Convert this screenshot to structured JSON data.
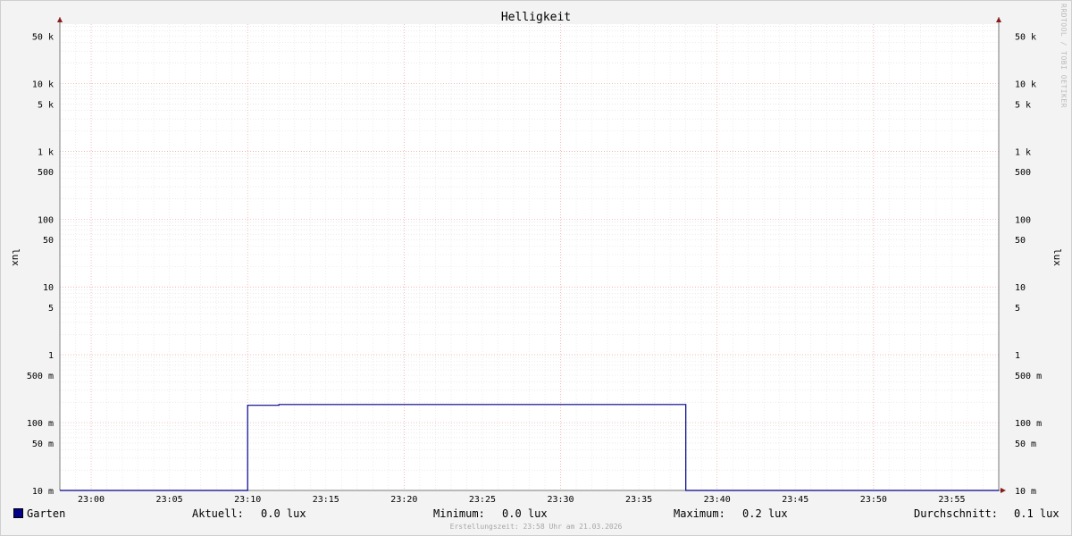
{
  "chart_data": {
    "type": "line",
    "title": "Helligkeit",
    "ylabel": "lux",
    "ylabel_right": "lux",
    "yscale": "log",
    "ylim": [
      0.01,
      75000
    ],
    "xlim": [
      "22:58",
      "23:58"
    ],
    "y_ticks": [
      {
        "value": 50000,
        "label": "50 k"
      },
      {
        "value": 10000,
        "label": "10 k"
      },
      {
        "value": 5000,
        "label": "5 k"
      },
      {
        "value": 1000,
        "label": "1 k"
      },
      {
        "value": 500,
        "label": "500"
      },
      {
        "value": 100,
        "label": "100"
      },
      {
        "value": 50,
        "label": "50"
      },
      {
        "value": 10,
        "label": "10"
      },
      {
        "value": 5,
        "label": "5"
      },
      {
        "value": 1,
        "label": "1"
      },
      {
        "value": 0.5,
        "label": "500 m"
      },
      {
        "value": 0.1,
        "label": "100 m"
      },
      {
        "value": 0.05,
        "label": "50 m"
      },
      {
        "value": 0.01,
        "label": "10 m"
      }
    ],
    "x_ticks": [
      "23:00",
      "23:05",
      "23:10",
      "23:15",
      "23:20",
      "23:25",
      "23:30",
      "23:35",
      "23:40",
      "23:45",
      "23:50",
      "23:55"
    ],
    "grid": true,
    "series": [
      {
        "name": "Garten",
        "color": "#00008b",
        "points": [
          [
            "22:58",
            0.01
          ],
          [
            "23:10",
            0.01
          ],
          [
            "23:10",
            0.18
          ],
          [
            "23:12",
            0.18
          ],
          [
            "23:12",
            0.185
          ],
          [
            "23:38",
            0.185
          ],
          [
            "23:38",
            0.01
          ],
          [
            "23:58",
            0.01
          ]
        ]
      }
    ]
  },
  "legend": {
    "series_name": "Garten",
    "swatch_color": "#00008b",
    "current_label": "Aktuell:",
    "current_value": "0.0 lux",
    "min_label": "Minimum:",
    "min_value": "0.0 lux",
    "max_label": "Maximum:",
    "max_value": "0.2 lux",
    "avg_label": "Durchschnitt:",
    "avg_value": "0.1 lux"
  },
  "footer": "Erstellungszeit: 23:58 Uhr am 21.03.2026",
  "watermark": "RRDTOOL / TOBI OETIKER"
}
